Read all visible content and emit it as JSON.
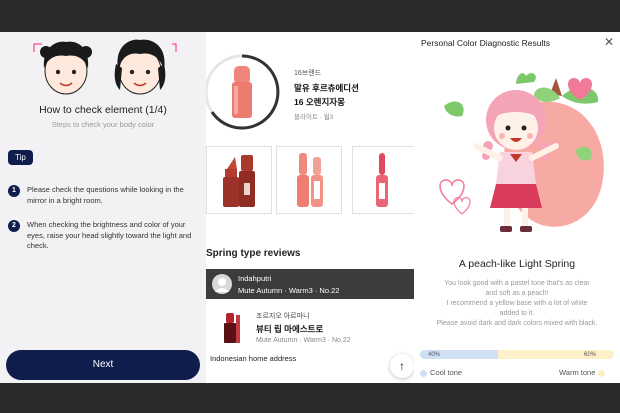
{
  "panel_guide": {
    "title": "How to check element (1/4)",
    "subtitle": "Steps to check your body color",
    "tip_label": "Tip",
    "steps": [
      {
        "num": "1",
        "text": "Please check the questions while looking in the mirror in a bright room."
      },
      {
        "num": "2",
        "text": "When checking the brightness and color of your eyes, raise your head slightly toward the light and check."
      }
    ],
    "next_label": "Next"
  },
  "panel_product": {
    "brand": "16브랜드",
    "name_line1": "말유 후르츄에디션",
    "name_line2": "16 오렌지자몽",
    "shade": "블라이트 · 웜3",
    "reviews_title": "Spring type reviews",
    "review_user": {
      "name": "Indahputri",
      "tags": "Mute Autumn · Warm3 · No.22"
    },
    "review_product": {
      "brand": "조르지오 아르마니",
      "name": "뷰티 립 마에스트로",
      "tags": "Mute Autumn · Warm3 · No.22"
    },
    "address": "Indonesian home address",
    "scroll_top_glyph": "↑"
  },
  "panel_result": {
    "title": "Personal Color Diagnostic Results",
    "close_glyph": "✕",
    "result_title": "A peach-like Light Spring",
    "desc_lines": [
      "You look good with a pastel tone that's as clear",
      "and soft as a peach!",
      "I recommend a yellow base with a lot of white",
      "added to it.",
      "Please avoid dark and dark colors mixed with black."
    ],
    "cool_label": "Cool tone",
    "warm_label": "Warm tone",
    "cool_percent_label": "40%",
    "warm_percent_label": "60%",
    "cool_fraction": 0.4,
    "colors": {
      "cool": "#cfe0f4",
      "warm": "#fdf0c8",
      "peach": "#f4a7a0",
      "navy": "#0f1d4d"
    }
  }
}
